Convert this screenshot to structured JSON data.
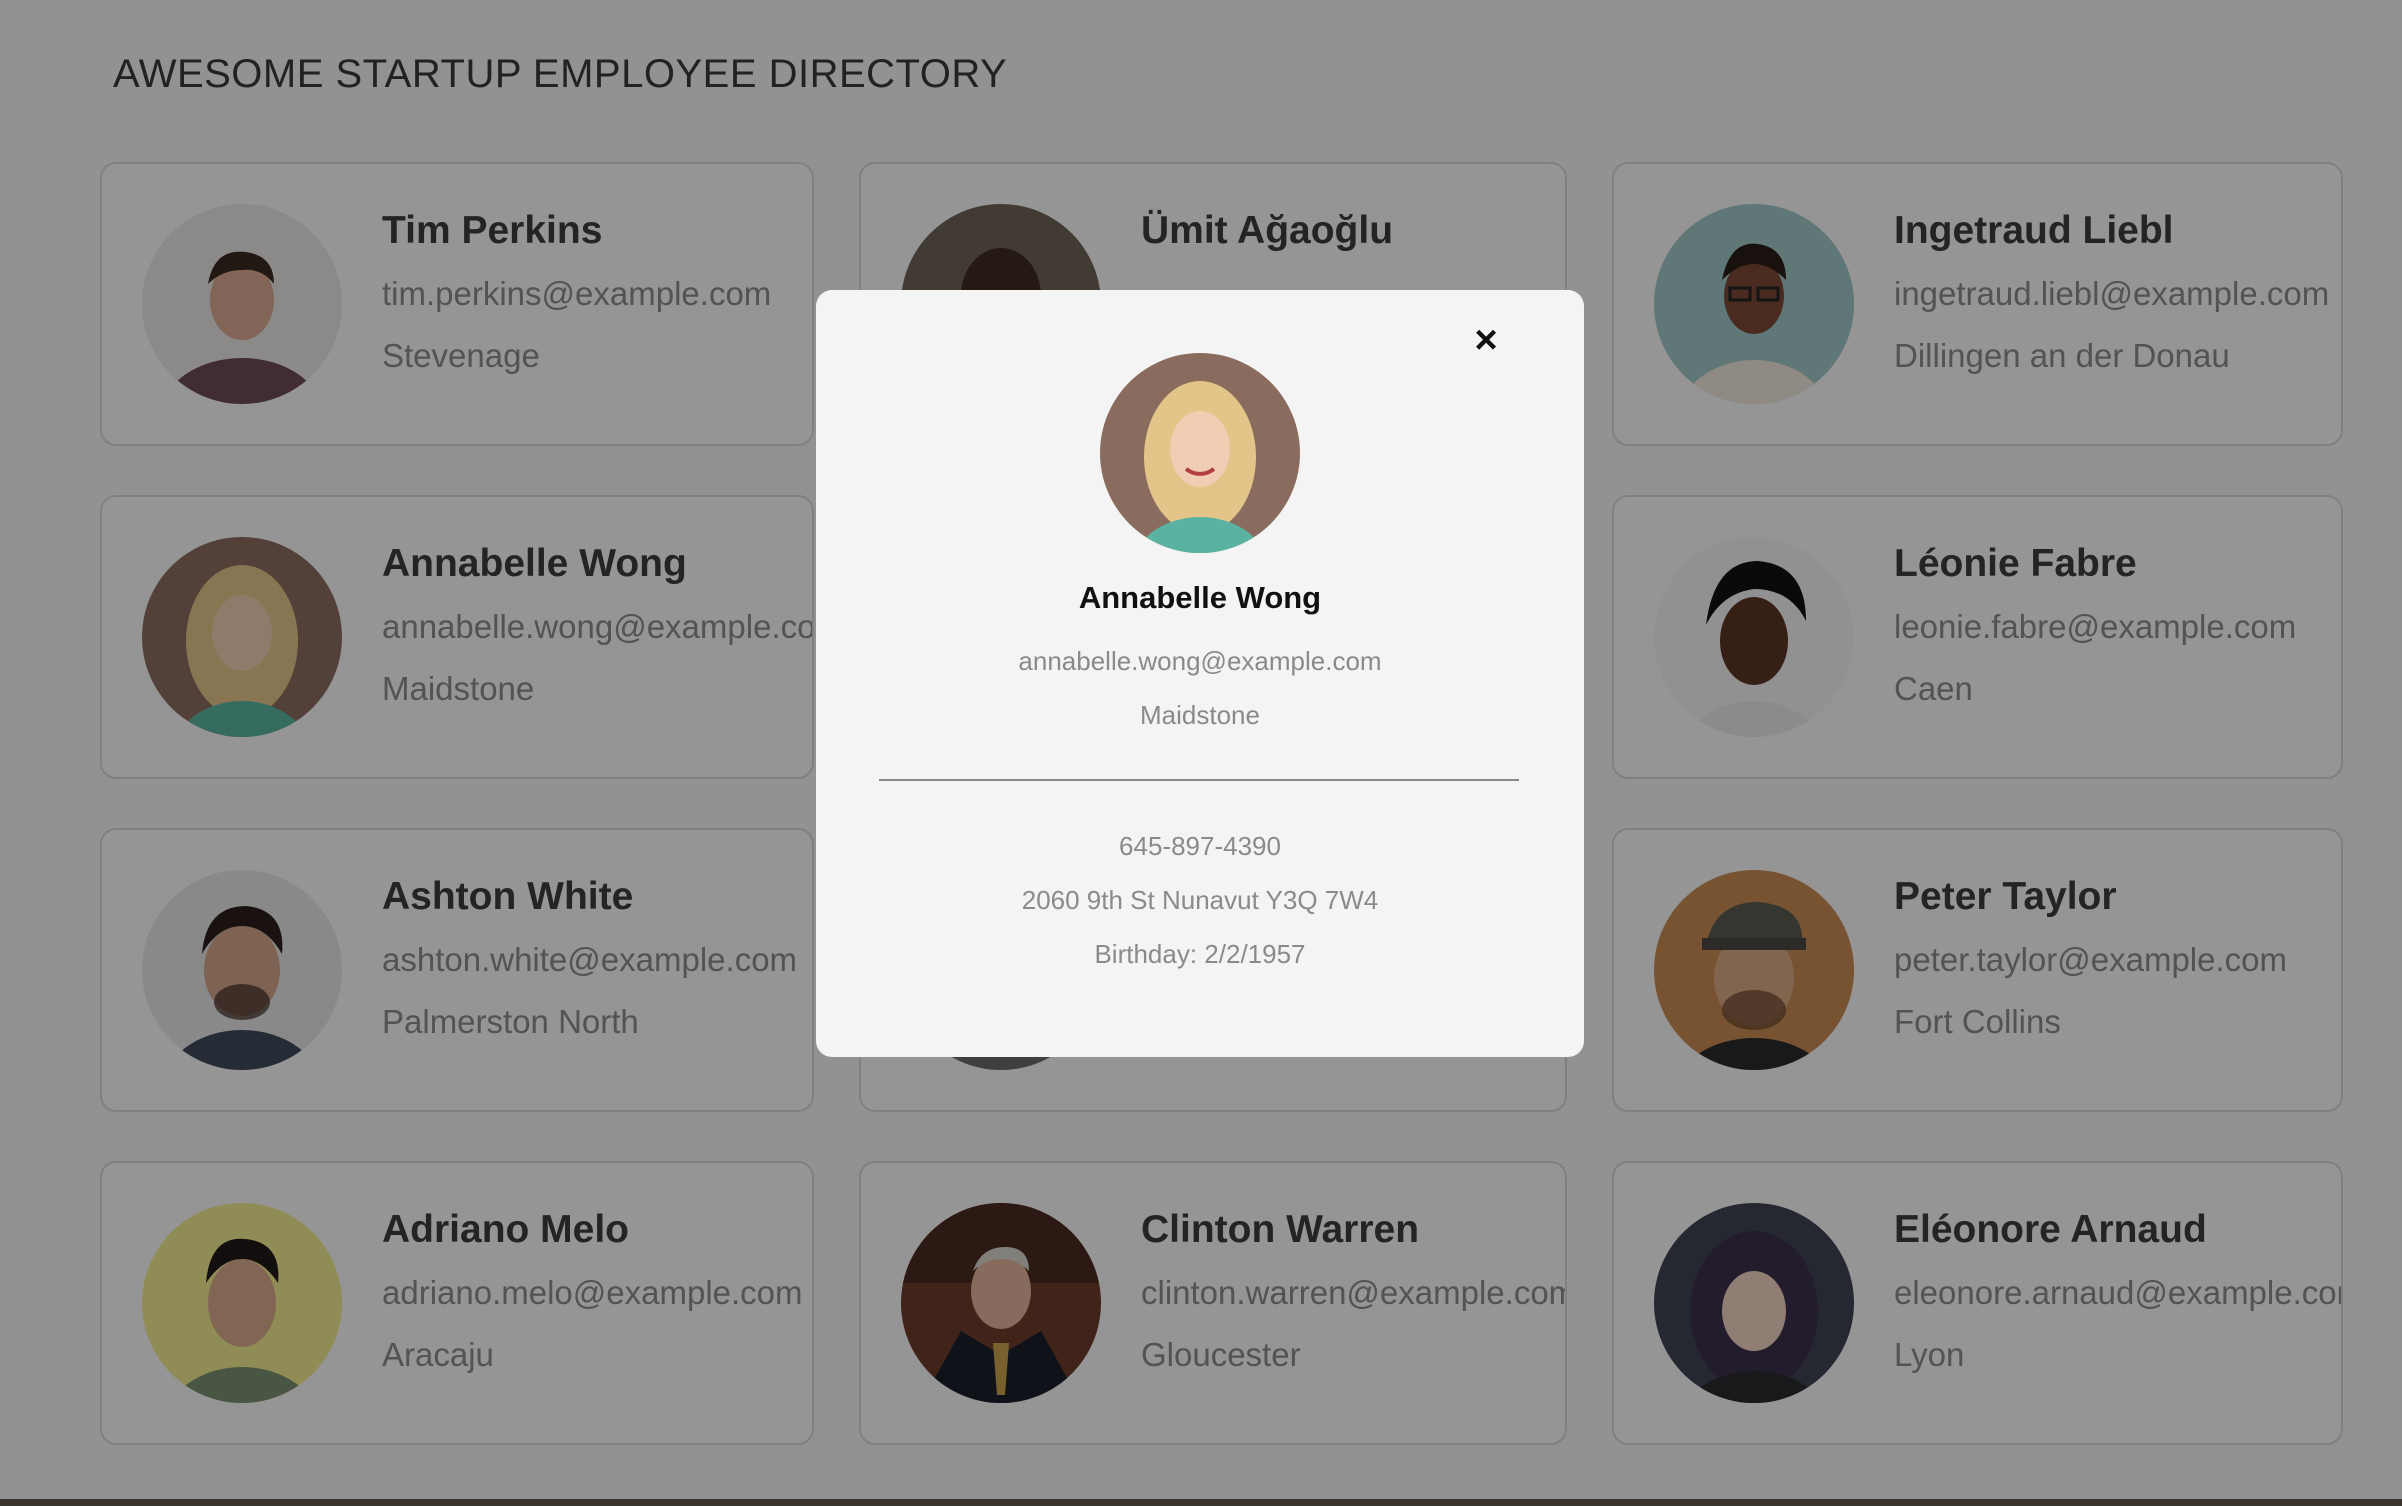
{
  "header": {
    "title": "AWESOME STARTUP EMPLOYEE DIRECTORY"
  },
  "employees": [
    {
      "name": "Tim Perkins",
      "email": "tim.perkins@example.com",
      "city": "Stevenage"
    },
    {
      "name": "Ümit Ağaoğlu",
      "email": "",
      "city": ""
    },
    {
      "name": "Ingetraud Liebl",
      "email": "ingetraud.liebl@example.com",
      "city": "Dillingen an der Donau"
    },
    {
      "name": "Annabelle Wong",
      "email": "annabelle.wong@example.com",
      "city": "Maidstone"
    },
    {
      "name": "",
      "email": "",
      "city": ""
    },
    {
      "name": "Léonie Fabre",
      "email": "leonie.fabre@example.com",
      "city": "Caen"
    },
    {
      "name": "Ashton White",
      "email": "ashton.white@example.com",
      "city": "Palmerston North"
    },
    {
      "name": "",
      "email": "",
      "city": ""
    },
    {
      "name": "Peter Taylor",
      "email": "peter.taylor@example.com",
      "city": "Fort Collins"
    },
    {
      "name": "Adriano Melo",
      "email": "adriano.melo@example.com",
      "city": "Aracaju"
    },
    {
      "name": "Clinton Warren",
      "email": "clinton.warren@example.com",
      "city": "Gloucester"
    },
    {
      "name": "Eléonore Arnaud",
      "email": "eleonore.arnaud@example.com",
      "city": "Lyon"
    }
  ],
  "modal": {
    "close_icon": "×",
    "name": "Annabelle Wong",
    "email": "annabelle.wong@example.com",
    "city": "Maidstone",
    "phone": "645-897-4390",
    "address": "2060 9th St Nunavut Y3Q 7W4",
    "birthday": "Birthday: 2/2/1957"
  },
  "colors": {
    "overlay": "rgba(0,0,0,0.4)",
    "modal_bg": "#f4f4f4",
    "card_border": "#d6d6d6"
  }
}
